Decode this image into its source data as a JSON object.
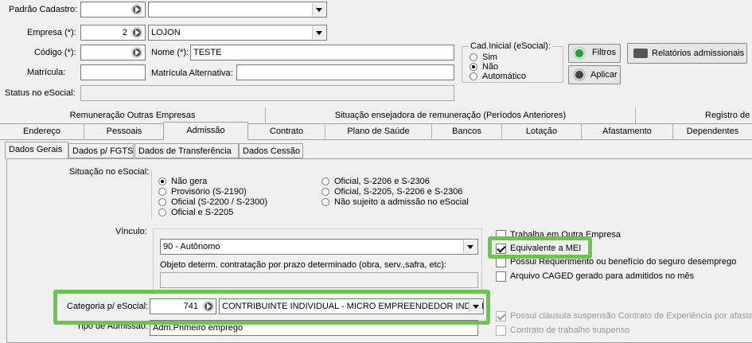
{
  "header": {
    "padrao_cadastro_label": "Padrão Cadastro:",
    "empresa_label": "Empresa (*):",
    "empresa_code": "2",
    "empresa_name": "LOJON",
    "codigo_label": "Código (*):",
    "nome_label": "Nome (*):",
    "nome_value": "TESTE",
    "matricula_label": "Matrícula:",
    "matricula_alt_label": "Matrícula Alternativa:",
    "status_label": "Status no eSocial:"
  },
  "cad_inicial": {
    "title": "Cad.Inicial (eSocial):",
    "options": [
      "Sim",
      "Não",
      "Automático"
    ],
    "selected": "Não"
  },
  "buttons": {
    "filtros": "Filtros",
    "aplicar": "Aplicar",
    "relatorios": "Relatórios admissionais"
  },
  "tabs_row1": [
    "Remuneração Outras Empresas",
    "Situação ensejadora de remuneração (Períodos Anteriores)",
    "Registro de"
  ],
  "tabs_row2": [
    "Endereço",
    "Pessoais",
    "Admissão",
    "Contrato",
    "Plano de Saúde",
    "Bancos",
    "Lotação",
    "Afastamento",
    "Dependentes"
  ],
  "active_tab": "Admissão",
  "subtabs": [
    "Dados Gerais",
    "Dados p/ FGTS",
    "Dados de Transferência",
    "Dados Cessão"
  ],
  "active_subtab": "Dados Gerais",
  "situacao": {
    "label": "Situação no eSocial:",
    "options_left": [
      "Não gera",
      "Provisório (S-2190)",
      "Oficial (S-2200 / S-2300)",
      "Oficial e S-2205"
    ],
    "options_right": [
      "Oficial, S-2206 e S-2306",
      "Oficial, S-2205, S-2206 e S-2306",
      "Não sujeito a admissão no eSocial"
    ],
    "selected": "Não gera"
  },
  "vinculo": {
    "label": "Vínculo:",
    "value": "90 - Autônomo",
    "objeto_label": "Objeto determ. contratação por prazo determinado (obra, serv.,safra, etc):"
  },
  "checkboxes": [
    {
      "label": "Trabalha em Outra Empresa",
      "checked": false,
      "enabled": true
    },
    {
      "label": "Equivalente a MEI",
      "checked": true,
      "enabled": true
    },
    {
      "label": "Possui Requerimento ou benefício do seguro desemprego",
      "checked": false,
      "enabled": true
    },
    {
      "label": "Arquivo CAGED gerado para admitidos no mês",
      "checked": false,
      "enabled": true
    },
    {
      "label": "Possui cláusula suspensão Contrato de Experiência por afastar",
      "checked": true,
      "enabled": false
    },
    {
      "label": "Contrato de trabalho suspenso",
      "checked": false,
      "enabled": false
    }
  ],
  "categoria": {
    "label": "Categoria p/ eSocial:",
    "code": "741",
    "value": "CONTRIBUINTE INDIVIDUAL - MICRO EMPREENDEDOR INDIVIDUAL"
  },
  "tipo_admissao": {
    "label": "Tipo de Admissão:",
    "value": "Adm.Primeiro emprego"
  },
  "colors": {
    "highlight": "#6cc44f"
  }
}
